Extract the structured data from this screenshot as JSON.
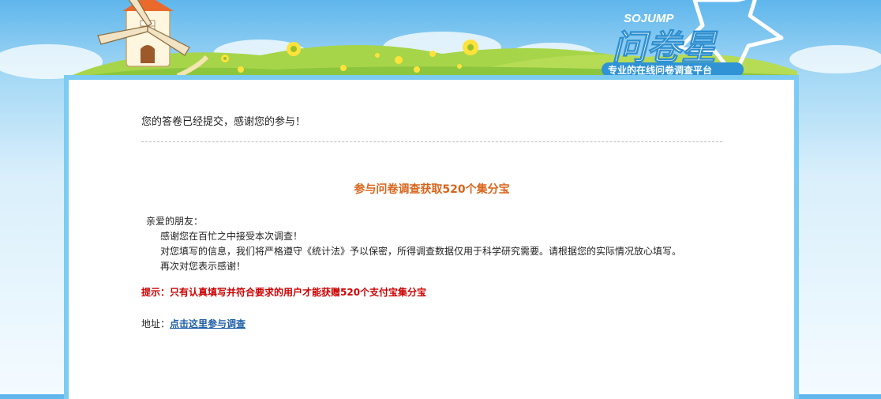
{
  "brand": {
    "logo_latin": "SOJUMP",
    "logo_cn": "问卷星",
    "tagline": "专业的在线问卷调查平台"
  },
  "confirmation": "您的答卷已经提交，感谢您的参与！",
  "headline": "参与问卷调查获取520个集分宝",
  "message": {
    "greeting": "亲爱的朋友：",
    "lines": [
      "感谢您在百忙之中接受本次调查！",
      "对您填写的信息，我们将严格遵守《统计法》予以保密，所得调查数据仅用于科学研究需要。请根据您的实际情况放心填写。",
      "再次对您表示感谢！"
    ]
  },
  "tip": "提示：只有认真填写并符合要求的用户才能获赠520个支付宝集分宝",
  "address": {
    "label": "地址：",
    "link_text": "点击这里参与调查"
  },
  "colors": {
    "panel_border": "#7ccbf2",
    "headline": "#d9641a",
    "tip": "#cc0000",
    "link": "#1f5fa8"
  }
}
